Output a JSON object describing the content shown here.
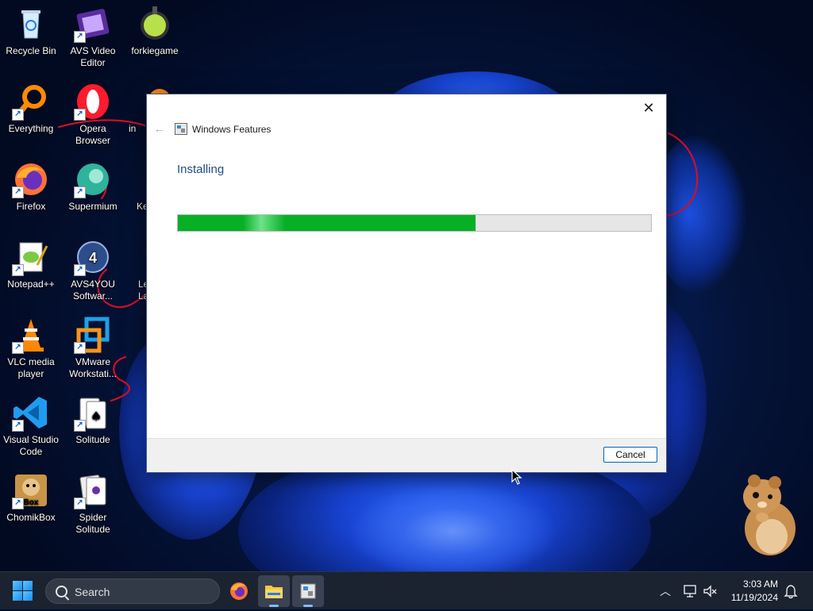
{
  "desktop": {
    "icons": [
      {
        "label": "Recycle Bin",
        "icon": "recycle-bin-icon"
      },
      {
        "label": "AVS Video Editor",
        "icon": "avs-video-editor-icon"
      },
      {
        "label": "forkiegame",
        "icon": "forkiegame-icon"
      },
      {
        "label": "Everything",
        "icon": "everything-search-icon"
      },
      {
        "label": "Opera Browser",
        "icon": "opera-icon"
      },
      {
        "label": "Firefox",
        "icon": "firefox-icon"
      },
      {
        "label": "Supermium",
        "icon": "supermium-icon"
      },
      {
        "label": "Notepad++",
        "icon": "notepad-plus-plus-icon"
      },
      {
        "label": "AVS4YOU Softwar...",
        "icon": "avs4you-icon"
      },
      {
        "label": "VLC media player",
        "icon": "vlc-icon"
      },
      {
        "label": "VMware Workstati...",
        "icon": "vmware-icon"
      },
      {
        "label": "Visual Studio Code",
        "icon": "vscode-icon"
      },
      {
        "label": "Solitude",
        "icon": "solitude-icon"
      },
      {
        "label": "ChomikBox",
        "icon": "chomikbox-icon"
      },
      {
        "label": "Spider Solitude",
        "icon": "spider-solitude-icon"
      }
    ],
    "partial_labels": [
      "in",
      "Kevi",
      "Le",
      "La"
    ]
  },
  "dialog": {
    "title": "Windows Features",
    "heading": "Installing",
    "progress_fraction": 0.63,
    "cancel_label": "Cancel",
    "close_glyph": "✕",
    "back_glyph": "←"
  },
  "taskbar": {
    "search_label": "Search",
    "apps": [
      "firefox-icon",
      "file-explorer-icon",
      "windows-features-icon"
    ],
    "time": "3:03 AM",
    "date": "11/19/2024",
    "colors": {
      "background": "#1b2230",
      "accent": "#0067c0",
      "progress_green": "#06b025"
    }
  }
}
